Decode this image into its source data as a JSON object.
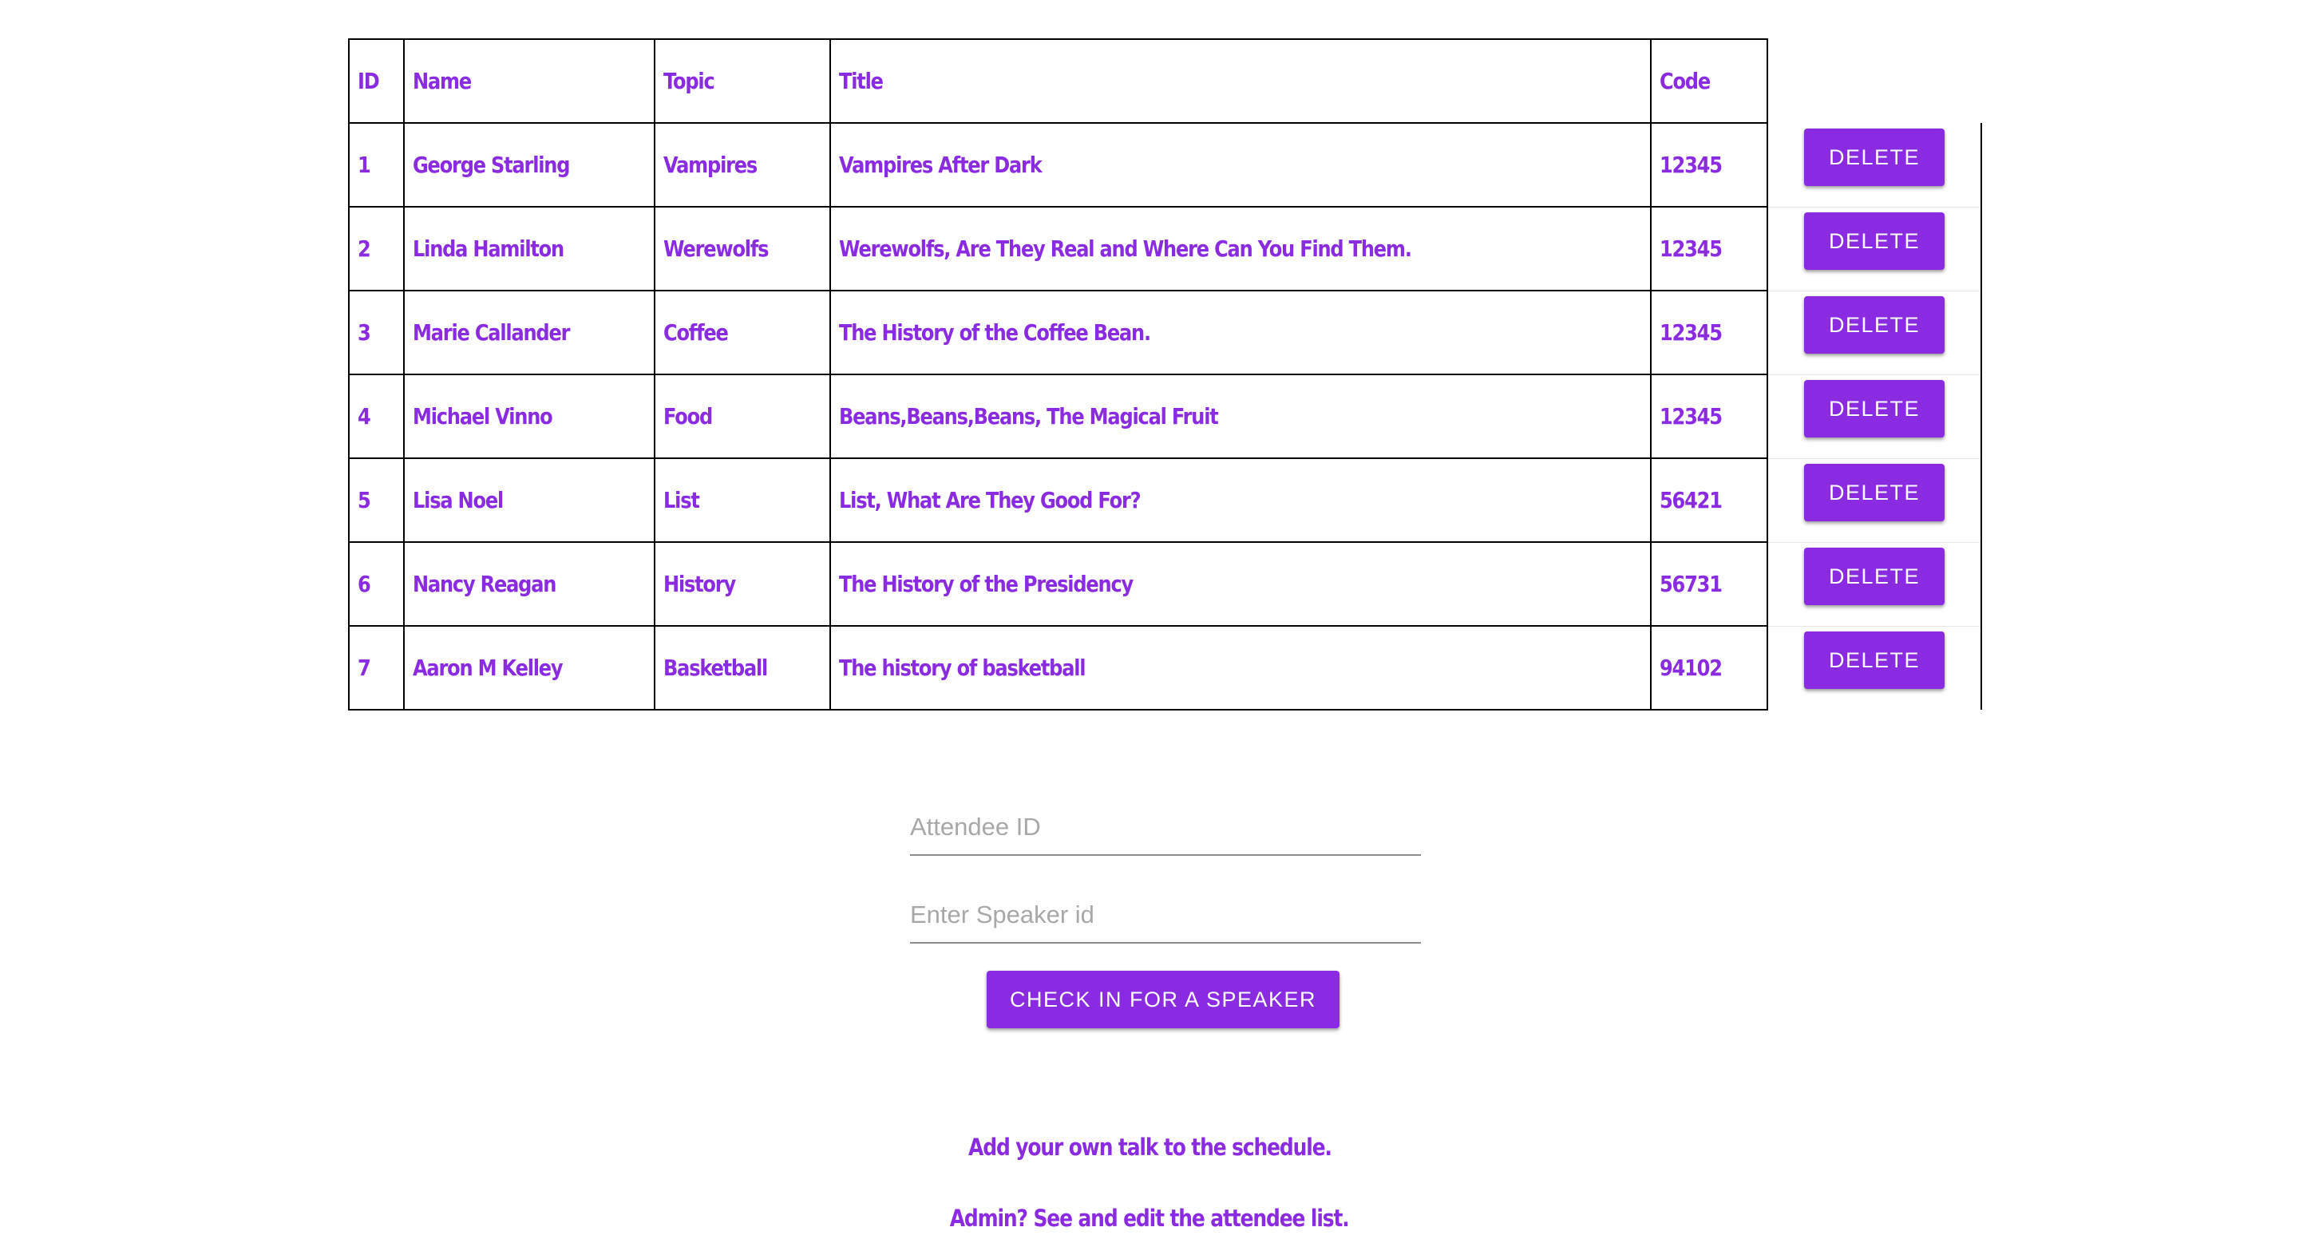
{
  "table": {
    "headers": {
      "id": "ID",
      "name": "Name",
      "topic": "Topic",
      "title": "Title",
      "code": "Code"
    },
    "delete_label": "DELETE",
    "rows": [
      {
        "id": "1",
        "name": "George Starling",
        "topic": "Vampires",
        "title": "Vampires After Dark",
        "code": "12345"
      },
      {
        "id": "2",
        "name": "Linda Hamilton",
        "topic": "Werewolfs",
        "title": "Werewolfs, Are They Real and Where Can You Find Them.",
        "code": "12345"
      },
      {
        "id": "3",
        "name": "Marie Callander",
        "topic": "Coffee",
        "title": "The History of the Coffee Bean.",
        "code": "12345"
      },
      {
        "id": "4",
        "name": "Michael Vinno",
        "topic": "Food",
        "title": "Beans,Beans,Beans, The Magical Fruit",
        "code": "12345"
      },
      {
        "id": "5",
        "name": "Lisa Noel",
        "topic": "List",
        "title": "List, What Are They Good For?",
        "code": "56421"
      },
      {
        "id": "6",
        "name": "Nancy Reagan",
        "topic": "History",
        "title": "The History of the Presidency",
        "code": "56731"
      },
      {
        "id": "7",
        "name": "Aaron M Kelley",
        "topic": "Basketball",
        "title": "The history of basketball",
        "code": "94102"
      }
    ]
  },
  "form": {
    "attendee_placeholder": "Attendee ID",
    "speaker_placeholder": "Enter Speaker id",
    "checkin_label": "CHECK IN FOR A SPEAKER"
  },
  "links": {
    "add_talk": "Add your own talk to the schedule.",
    "admin": "Admin? See and edit the attendee list."
  },
  "colors": {
    "accent": "#8a2be2",
    "border": "#000000",
    "placeholder": "#a8a8a8"
  }
}
